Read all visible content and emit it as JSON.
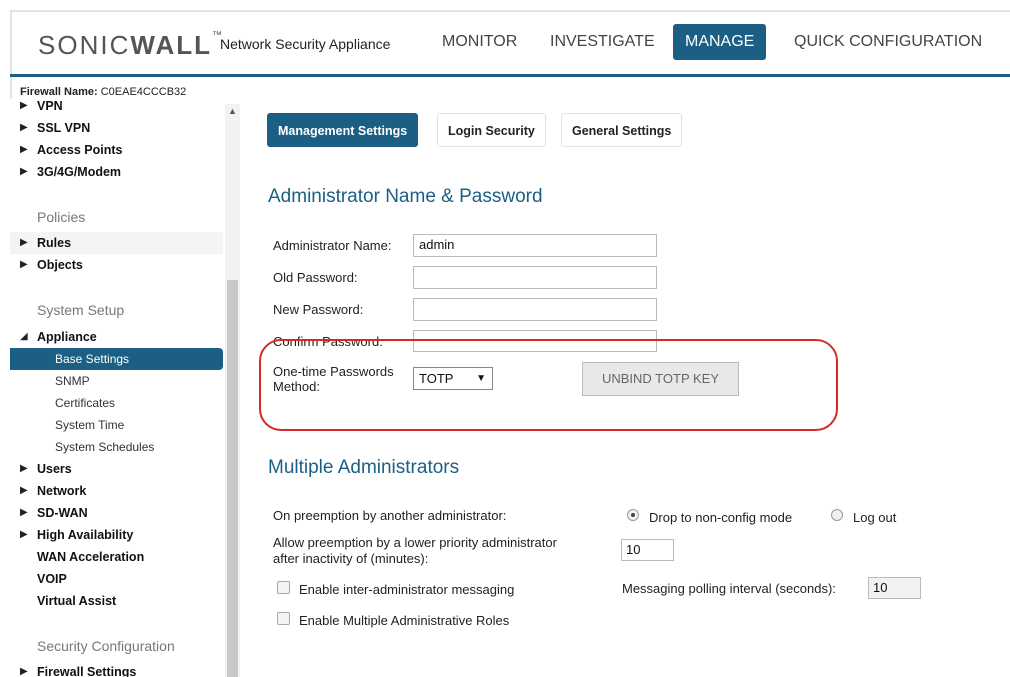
{
  "brand": {
    "logo_left": "SONIC",
    "logo_right": "WALL",
    "tm": "™",
    "subtitle": "Network Security Appliance"
  },
  "nav": {
    "monitor": "MONITOR",
    "investigate": "INVESTIGATE",
    "manage": "MANAGE",
    "quick": "QUICK CONFIGURATION"
  },
  "firewall": {
    "label": "Firewall Name:",
    "value": "C0EAE4CCCB32"
  },
  "sidebar": {
    "vpn": "VPN",
    "sslvpn": "SSL VPN",
    "access_points": "Access Points",
    "modem": "3G/4G/Modem",
    "policies": "Policies",
    "rules": "Rules",
    "objects": "Objects",
    "system_setup": "System Setup",
    "appliance": "Appliance",
    "base_settings": "Base Settings",
    "snmp": "SNMP",
    "certificates": "Certificates",
    "system_time": "System Time",
    "system_schedules": "System Schedules",
    "users": "Users",
    "network": "Network",
    "sdwan": "SD-WAN",
    "high_availability": "High Availability",
    "wan_acceleration": "WAN Acceleration",
    "voip": "VOIP",
    "virtual_assist": "Virtual Assist",
    "security_configuration": "Security Configuration",
    "firewall_settings": "Firewall Settings"
  },
  "tabs": {
    "management": "Management Settings",
    "login_security": "Login Security",
    "general": "General Settings"
  },
  "admin": {
    "title": "Administrator Name & Password",
    "name_label": "Administrator Name:",
    "name_value": "admin",
    "old_pw_label": "Old Password:",
    "new_pw_label": "New Password:",
    "confirm_pw_label": "Confirm Password:",
    "otp_label_1": "One-time Passwords",
    "otp_label_2": "Method:",
    "otp_value": "TOTP",
    "unbind_label": "UNBIND TOTP KEY"
  },
  "multi": {
    "title": "Multiple Administrators",
    "preemption_label": "On preemption by another administrator:",
    "opt_drop": "Drop to non-config mode",
    "opt_logout": "Log out",
    "allow_label_1": "Allow preemption by a lower priority administrator",
    "allow_label_2": "after inactivity of (minutes):",
    "allow_value": "10",
    "inter_admin_label": "Enable inter-administrator messaging",
    "polling_label": "Messaging polling interval (seconds):",
    "polling_value": "10",
    "multi_roles_label": "Enable Multiple Administrative Roles"
  }
}
